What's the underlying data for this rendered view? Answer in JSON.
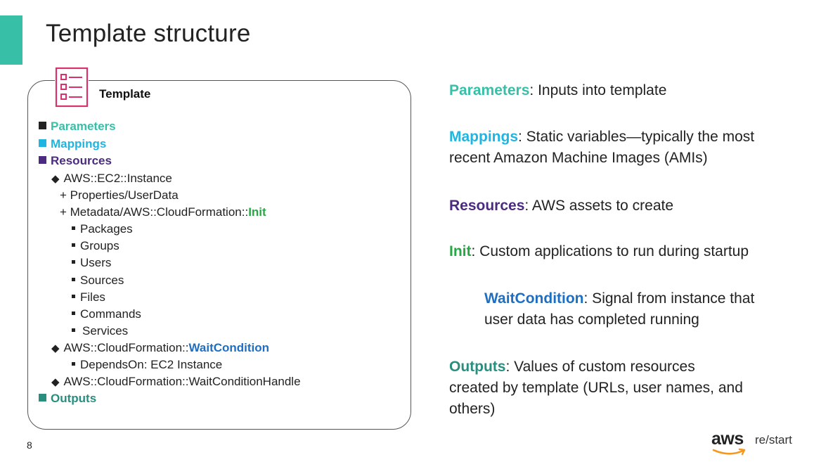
{
  "slide": {
    "title": "Template structure",
    "page_number": "8",
    "accent_color": "#37bfa7"
  },
  "panel": {
    "icon": "template-checklist-icon",
    "label": "Template",
    "items": {
      "parameters": "Parameters",
      "mappings": "Mappings",
      "resources": "Resources",
      "ec2_instance": "AWS::EC2::Instance",
      "properties": "+ Properties/UserData",
      "metadata_prefix": "+ Metadata/AWS::CloudFormation::",
      "metadata_init": "Init",
      "packages": "Packages",
      "groups": "Groups",
      "users": "Users",
      "sources": "Sources",
      "files": "Files",
      "commands": "Commands",
      "services": "Services",
      "wait_prefix": "AWS::CloudFormation::",
      "wait_condition": "WaitCondition",
      "depends_on": "DependsOn: EC2 Instance",
      "wait_handle": "AWS::CloudFormation::WaitConditionHandle",
      "outputs": "Outputs"
    }
  },
  "descriptions": {
    "parameters": {
      "term": "Parameters",
      "text": ": Inputs into template"
    },
    "mappings": {
      "term": "Mappings",
      "text": ": Static variables—typically the most",
      "text2": "recent Amazon Machine Images (AMIs)"
    },
    "resources": {
      "term": "Resources",
      "text": ": AWS assets to create"
    },
    "init": {
      "term": "Init",
      "text": ": Custom applications to run during startup"
    },
    "waitcondition": {
      "term": "WaitCondition",
      "text": ": Signal from instance that",
      "text2": "user data has completed running"
    },
    "outputs": {
      "term": "Outputs",
      "text": ": Values of custom resources",
      "text2": "created by template (URLs, user names, and",
      "text3": "others)"
    }
  },
  "logo": {
    "brand": "aws",
    "product": "re/start"
  },
  "colors": {
    "parameters": "#37bfa7",
    "mappings": "#1fb5e0",
    "resources": "#4b2b7f",
    "init": "#27a844",
    "waitcondition": "#1e6fc2",
    "outputs": "#2a8e7e",
    "icon": "#d6336c"
  }
}
